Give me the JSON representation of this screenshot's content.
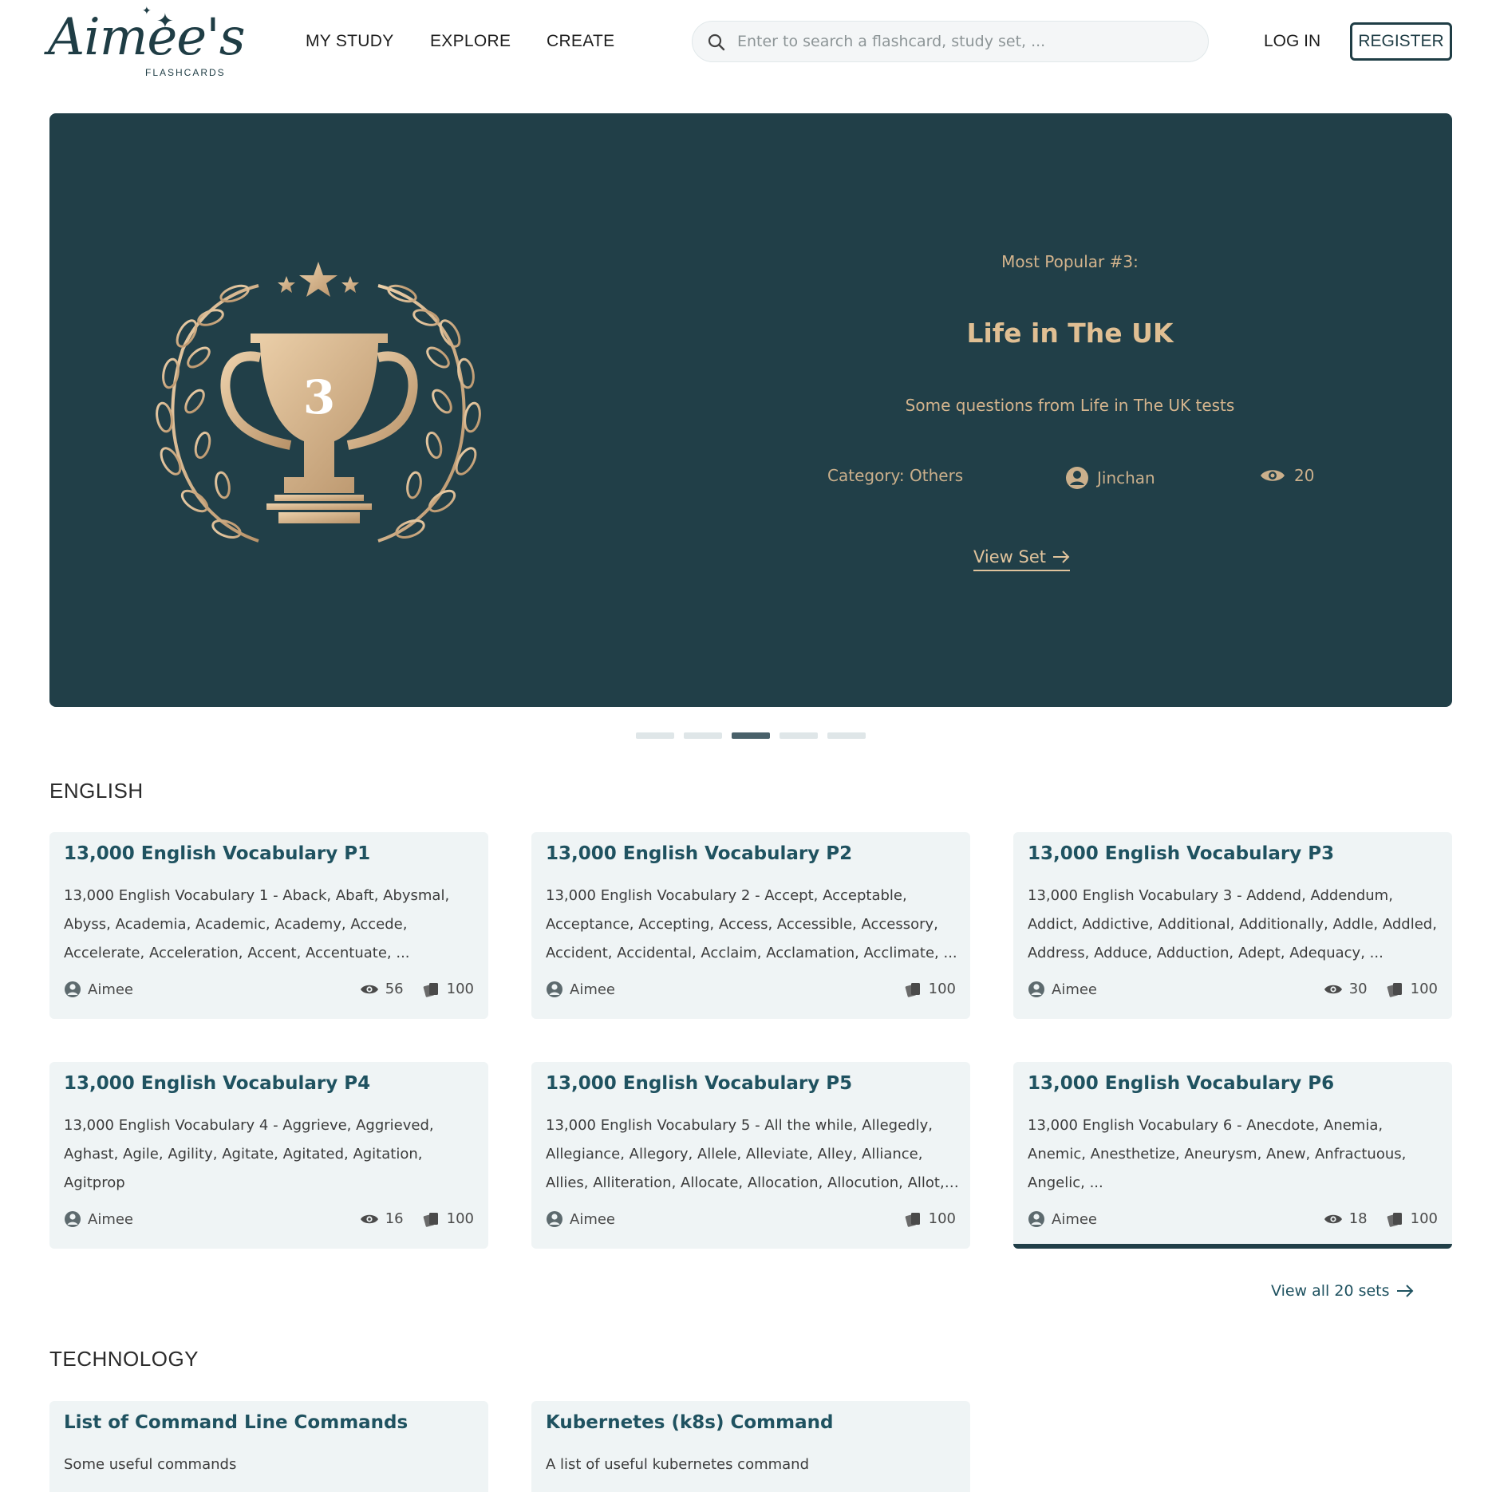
{
  "header": {
    "logo_text": "Aimee's",
    "logo_sub": "FLASHCARDS",
    "nav": [
      "MY STUDY",
      "EXPLORE",
      "CREATE"
    ],
    "search_placeholder": "Enter to search a flashcard, study set, ...",
    "login_label": "LOG IN",
    "register_label": "REGISTER"
  },
  "hero": {
    "badge_number": "3",
    "subtitle": "Most Popular #3:",
    "title": "Life in The UK",
    "description": "Some questions from Life in The UK tests",
    "category": "Category: Others",
    "author": "Jinchan",
    "views": "20",
    "view_set_label": "View Set",
    "active_slide": 3,
    "slide_count": 5
  },
  "sections": [
    {
      "title": "ENGLISH",
      "view_all_label": "View all 20 sets",
      "cards": [
        {
          "title": "13,000 English Vocabulary P1",
          "desc": "13,000 English Vocabulary 1 - Aback, Abaft, Abysmal, Abyss, Academia, Academic, Academy, Accede, Accelerate, Acceleration, Accent, Accentuate, ...",
          "author": "Aimee",
          "views": "56",
          "cards": "100"
        },
        {
          "title": "13,000 English Vocabulary P2",
          "desc": "13,000 English Vocabulary 2 - Accept, Acceptable, Acceptance, Accepting, Access, Accessible, Accessory, Accident, Accidental, Acclaim, Acclamation, Acclimate, ...",
          "author": "Aimee",
          "views": "",
          "cards": "100"
        },
        {
          "title": "13,000 English Vocabulary P3",
          "desc": "13,000 English Vocabulary 3 - Addend, Addendum, Addict, Addictive, Additional, Additionally, Addle, Addled, Address, Adduce, Adduction, Adept, Adequacy, ...",
          "author": "Aimee",
          "views": "30",
          "cards": "100"
        },
        {
          "title": "13,000 English Vocabulary P4",
          "desc": "13,000 English Vocabulary 4 - Aggrieve, Aggrieved, Aghast, Agile, Agility, Agitate, Agitated, Agitation, Agitprop",
          "author": "Aimee",
          "views": "16",
          "cards": "100"
        },
        {
          "title": "13,000 English Vocabulary P5",
          "desc": "13,000 English Vocabulary 5 - All the while, Allegedly, Allegiance, Allegory, Allele, Alleviate, Alley, Alliance, Allies, Alliteration, Allocate, Allocation, Allocution, Allot, ...",
          "author": "Aimee",
          "views": "",
          "cards": "100"
        },
        {
          "title": "13,000 English Vocabulary P6",
          "desc": "13,000 English Vocabulary 6 - Anecdote, Anemia, Anemic, Anesthetize, Aneurysm, Anew, Anfractuous, Angelic, ...",
          "author": "Aimee",
          "views": "18",
          "cards": "100"
        }
      ]
    },
    {
      "title": "TECHNOLOGY",
      "cards": [
        {
          "title": "List of Command Line Commands",
          "desc": "Some useful commands"
        },
        {
          "title": "Kubernetes (k8s) Command",
          "desc": "A list of useful kubernetes command"
        }
      ]
    }
  ],
  "colors": {
    "brand": "#1f3d45",
    "hero_bg": "#213f48",
    "gold": "#d4b48d",
    "card_bg": "#eff4f5",
    "card_title": "#1f5260"
  }
}
